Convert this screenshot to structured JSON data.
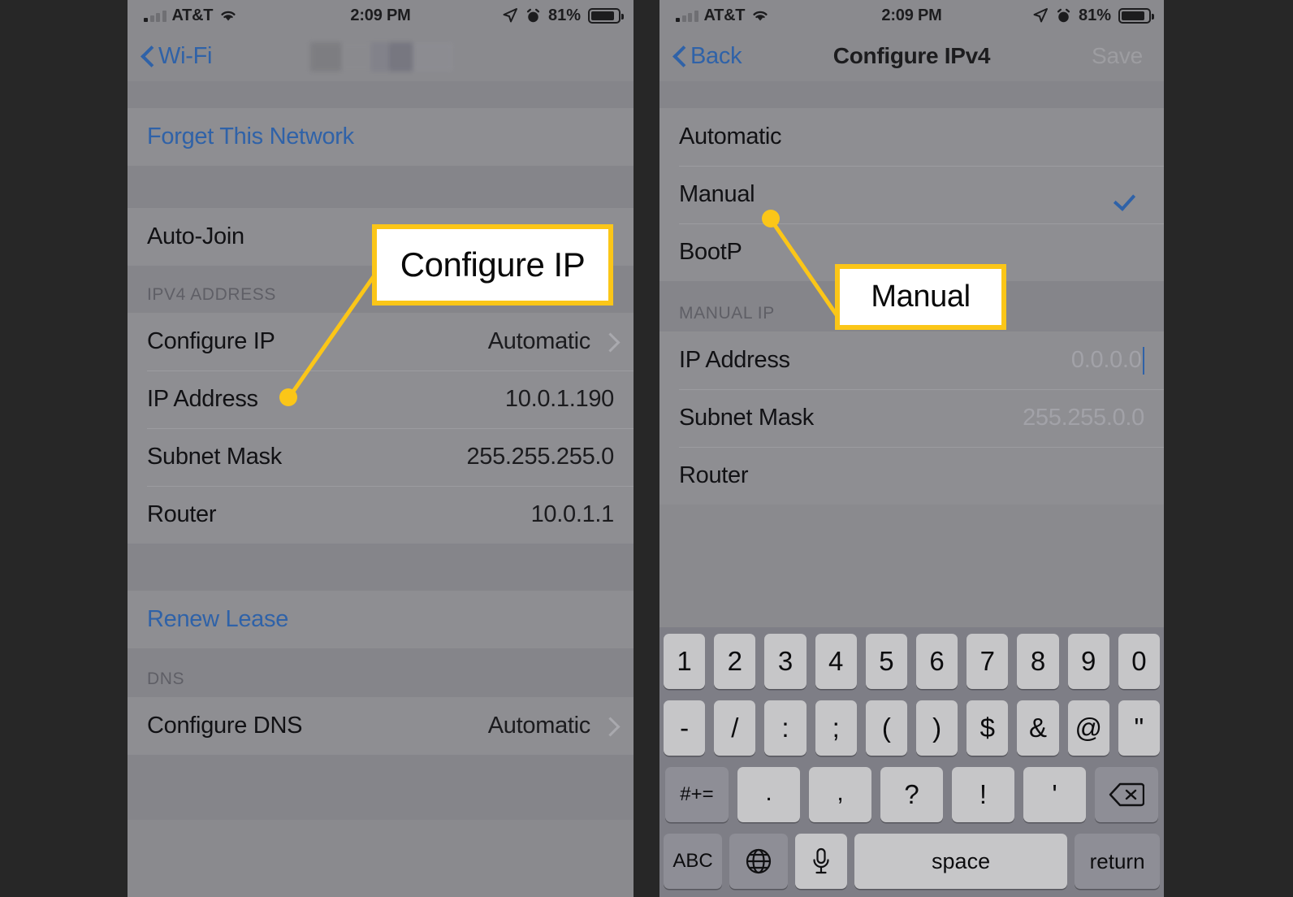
{
  "status_bar": {
    "carrier": "AT&T",
    "time": "2:09 PM",
    "battery_percent": "81%",
    "icons": [
      "signal-bars-icon",
      "wifi-icon",
      "location-arrow-icon",
      "alarm-clock-icon",
      "battery-icon"
    ]
  },
  "colors": {
    "accent_yellow": "#FBC618",
    "ios_blue": "#2F62A8",
    "panel_bg": "#8E8E92",
    "page_bg": "#272727"
  },
  "left_screen": {
    "nav": {
      "back_label": "Wi-Fi",
      "title_redacted": true
    },
    "rows": [
      {
        "label": "Forget This Network",
        "value": "",
        "style": "link"
      },
      {
        "label": "Auto-Join",
        "value": "",
        "style": "plain"
      }
    ],
    "section_ipv4": {
      "header": "IPV4 ADDRESS",
      "rows": [
        {
          "label": "Configure IP",
          "value": "Automatic",
          "chevron": true
        },
        {
          "label": "IP Address",
          "value": "10.0.1.190",
          "chevron": false
        },
        {
          "label": "Subnet Mask",
          "value": "255.255.255.0",
          "chevron": false
        },
        {
          "label": "Router",
          "value": "10.0.1.1",
          "chevron": false
        }
      ]
    },
    "renew_lease_label": "Renew Lease",
    "section_dns": {
      "header": "DNS",
      "rows": [
        {
          "label": "Configure DNS",
          "value": "Automatic",
          "chevron": true
        }
      ]
    }
  },
  "right_screen": {
    "nav": {
      "back_label": "Back",
      "title": "Configure IPv4",
      "save_label": "Save"
    },
    "options": [
      {
        "label": "Automatic",
        "selected": false
      },
      {
        "label": "Manual",
        "selected": true
      },
      {
        "label": "BootP",
        "selected": false
      }
    ],
    "section_manual_ip": {
      "header": "MANUAL IP",
      "rows": [
        {
          "label": "IP Address",
          "placeholder": "0.0.0.0",
          "focused": true
        },
        {
          "label": "Subnet Mask",
          "placeholder": "255.255.0.0",
          "focused": false
        },
        {
          "label": "Router",
          "placeholder": "",
          "focused": false
        }
      ]
    },
    "keyboard": {
      "row1": [
        "1",
        "2",
        "3",
        "4",
        "5",
        "6",
        "7",
        "8",
        "9",
        "0"
      ],
      "row2": [
        "-",
        "/",
        ":",
        ";",
        "(",
        ")",
        "$",
        "&",
        "@",
        "\""
      ],
      "row3": [
        "#+=",
        ".",
        ",",
        "?",
        "!",
        "'",
        "delete-icon"
      ],
      "row4": [
        "ABC",
        "globe-icon",
        "microphone-icon",
        "space",
        "return"
      ]
    }
  },
  "callouts": [
    {
      "text": "Configure IP",
      "target": "Configure IP row on Wi-Fi details screen"
    },
    {
      "text": "Manual",
      "target": "Manual option on Configure IPv4 screen"
    }
  ]
}
